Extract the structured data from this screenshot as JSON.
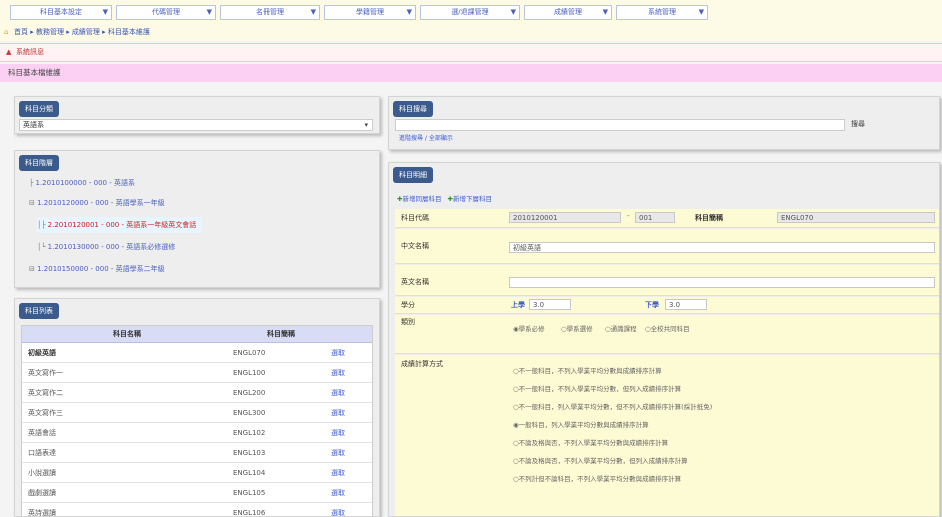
{
  "menu": [
    "科目基本設定",
    "代碼管理",
    "名冊管理",
    "學籍管理",
    "選/退課管理",
    "成績管理",
    "系統管理"
  ],
  "breadcrumb": "首頁 ▸ 教務管理 ▸ 成績管理 ▸ 科目基本維護",
  "notice": "系統訊息",
  "page_title": "科目基本檔維護",
  "panel_category": {
    "tab": "科目分類",
    "select_value": "英語系"
  },
  "panel_search": {
    "tab": "科目搜尋",
    "search_button": "搜尋",
    "links": "進階搜尋 / 全部顯示"
  },
  "panel_tree": {
    "tab": "科目階層",
    "items": [
      {
        "expander": "├",
        "label": "1.2010100000 - 000 - 英語系"
      },
      {
        "expander": "⊟",
        "label": "1.2010120000 - 000 - 英語學系一年級"
      },
      {
        "expander": "│├",
        "label": "2.2010120001 - 000 - 英語系一年級英文會話"
      },
      {
        "expander": "│└",
        "label": "1.2010130000 - 000 - 英語系必修選修"
      },
      {
        "expander": "⊟",
        "label": "1.2010150000 - 000 - 英語學系二年級"
      }
    ]
  },
  "panel_list": {
    "tab": "科目列表",
    "columns": [
      "科目名稱",
      "科目簡稱",
      ""
    ],
    "rows": [
      {
        "name": "初級英語",
        "abbr": "ENGL070",
        "action": "選取"
      },
      {
        "name": "英文寫作一",
        "abbr": "ENGL100",
        "action": "選取"
      },
      {
        "name": "英文寫作二",
        "abbr": "ENGL200",
        "action": "選取"
      },
      {
        "name": "英文寫作三",
        "abbr": "ENGL300",
        "action": "選取"
      },
      {
        "name": "英語會話",
        "abbr": "ENGL102",
        "action": "選取"
      },
      {
        "name": "口語表達",
        "abbr": "ENGL103",
        "action": "選取"
      },
      {
        "name": "小說選讀",
        "abbr": "ENGL104",
        "action": "選取"
      },
      {
        "name": "戲劇選讀",
        "abbr": "ENGL105",
        "action": "選取"
      },
      {
        "name": "英詩選讀",
        "abbr": "ENGL106",
        "action": "選取"
      }
    ]
  },
  "panel_detail": {
    "tab": "科目明細",
    "add_same_level": "新增同層科目",
    "add_sub_level": "新增下層科目",
    "labels": {
      "code": "科目代碼",
      "abbr": "科目簡稱",
      "cname": "中文名稱",
      "ename": "英文名稱",
      "credit": "學分",
      "category": "類別",
      "grading": "成績計算方式"
    },
    "code_value": "2010120001",
    "code_suffix": "001",
    "abbr_value": "ENGL070",
    "cname_value": "初級英語",
    "ename_value": "",
    "credit_up_label": "上學",
    "credit_up_value": "3.0",
    "credit_down_label": "下學",
    "credit_down_value": "3.0",
    "category_options": [
      "學系必修",
      "學系選修",
      "通識課程",
      "全校共同科目"
    ],
    "grading_options": [
      "不一般科目，不列入學業平均分數與成績排序計算",
      "不一般科目，不列入學業平均分數，但列入成績排序計算",
      "不一般科目，列入學業平均分數，但不列入成績排序計算(採計抵免)",
      "一般科目，列入學業平均分數與成績排序計算",
      "不論及格與否，不列入學業平均分數與成績排序計算",
      "不論及格與否，不列入學業平均分數，但列入成績排序計算",
      "不列計但不論科目，不列入學業平均分數與成績排序計算"
    ]
  }
}
